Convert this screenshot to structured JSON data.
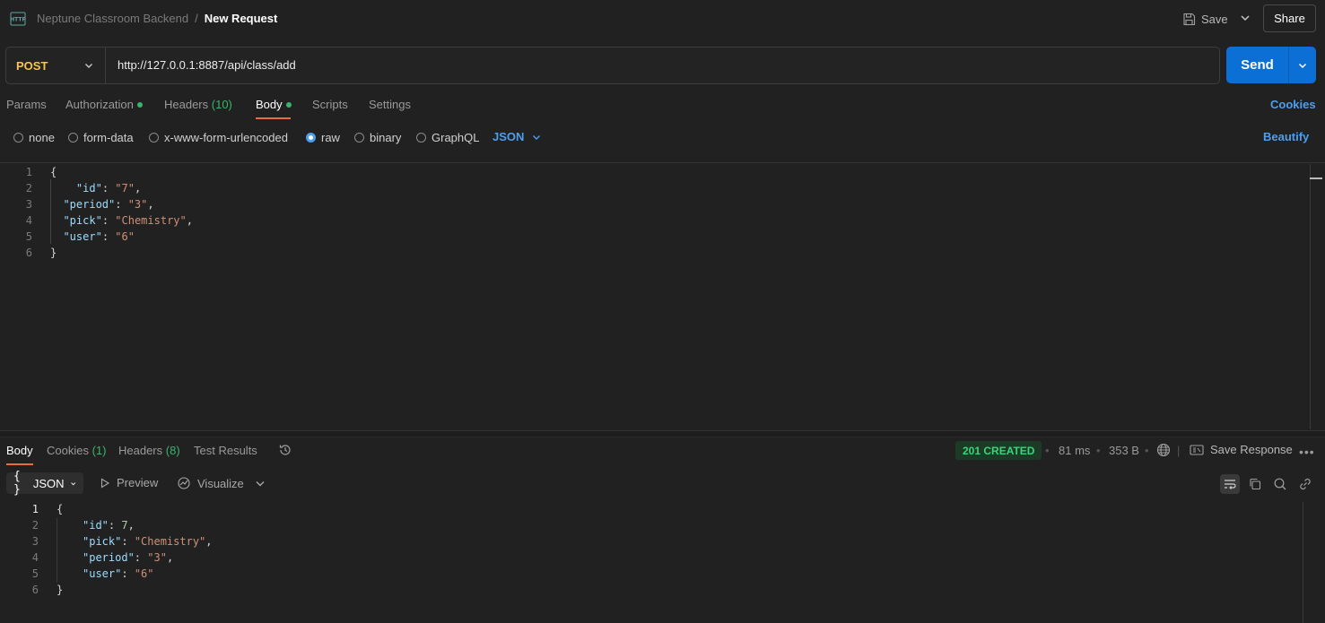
{
  "header": {
    "collection": "Neptune Classroom Backend",
    "separator": "/",
    "request_name": "New Request",
    "save_label": "Save",
    "share_label": "Share"
  },
  "request": {
    "method": "POST",
    "url": "http://127.0.0.1:8887/api/class/add",
    "send_label": "Send"
  },
  "request_tabs": {
    "params": "Params",
    "authorization": "Authorization",
    "headers": "Headers",
    "headers_count": "(10)",
    "body": "Body",
    "scripts": "Scripts",
    "settings": "Settings",
    "cookies": "Cookies"
  },
  "body_types": {
    "none": "none",
    "form_data": "form-data",
    "urlencoded": "x-www-form-urlencoded",
    "raw": "raw",
    "binary": "binary",
    "graphql": "GraphQL",
    "selected": "raw",
    "language": "JSON",
    "beautify": "Beautify"
  },
  "request_body": {
    "line_numbers": [
      "1",
      "2",
      "3",
      "4",
      "5",
      "6"
    ],
    "lines": [
      {
        "indent": "",
        "key": "",
        "value": "",
        "text": "{"
      },
      {
        "indent": "    ",
        "key": "\"id\"",
        "value": "\"7\"",
        "trail": ","
      },
      {
        "indent": "  ",
        "key": "\"period\"",
        "value": "\"3\"",
        "trail": ","
      },
      {
        "indent": "  ",
        "key": "\"pick\"",
        "value": "\"Chemistry\"",
        "trail": ","
      },
      {
        "indent": "  ",
        "key": "\"user\"",
        "value": "\"6\"",
        "trail": ""
      },
      {
        "indent": "",
        "key": "",
        "value": "",
        "text": "}"
      }
    ]
  },
  "response_tabs": {
    "body": "Body",
    "cookies": "Cookies",
    "cookies_count": "(1)",
    "headers": "Headers",
    "headers_count": "(8)",
    "test_results": "Test Results"
  },
  "response_meta": {
    "status": "201 CREATED",
    "time": "81 ms",
    "size": "353 B",
    "save_response": "Save Response"
  },
  "response_toolbar": {
    "format_icon": "{ }",
    "format": "JSON",
    "preview": "Preview",
    "visualize": "Visualize"
  },
  "response_body": {
    "line_numbers": [
      "1",
      "2",
      "3",
      "4",
      "5",
      "6"
    ],
    "lines": [
      {
        "text": "{"
      },
      {
        "key": "\"id\"",
        "value": "7",
        "trail": ","
      },
      {
        "key": "\"pick\"",
        "value": "\"Chemistry\"",
        "trail": ","
      },
      {
        "key": "\"period\"",
        "value": "\"3\"",
        "trail": ","
      },
      {
        "key": "\"user\"",
        "value": "\"6\"",
        "trail": ""
      },
      {
        "text": "}"
      }
    ]
  },
  "colors": {
    "accent_blue": "#0b6fd5",
    "method_post": "#f5c64f",
    "status_green": "#3bd47b",
    "tab_underline": "#e86c3c"
  }
}
